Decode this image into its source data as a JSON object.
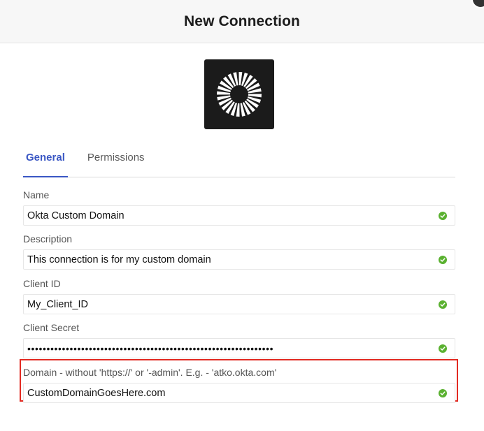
{
  "dialog": {
    "title": "New Connection"
  },
  "logo": {
    "name": "okta-logo-icon"
  },
  "tabs": [
    {
      "label": "General",
      "active": true
    },
    {
      "label": "Permissions",
      "active": false
    }
  ],
  "fields": {
    "name": {
      "label": "Name",
      "value": "Okta Custom Domain",
      "valid": true
    },
    "description": {
      "label": "Description",
      "value": "This connection is for my custom domain",
      "valid": true
    },
    "client_id": {
      "label": "Client ID",
      "value": "My_Client_ID",
      "valid": true
    },
    "client_secret": {
      "label": "Client Secret",
      "value": "••••••••••••••••••••••••••••••••••••••••••••••••••••••••••••••••",
      "valid": true
    },
    "domain": {
      "label": "Domain - without 'https://' or '-admin'. E.g. - 'atko.okta.com'",
      "value": "CustomDomainGoesHere.com",
      "valid": true
    }
  },
  "colors": {
    "accent": "#3a57c4",
    "valid": "#5ab130",
    "highlight": "#e22a22"
  }
}
